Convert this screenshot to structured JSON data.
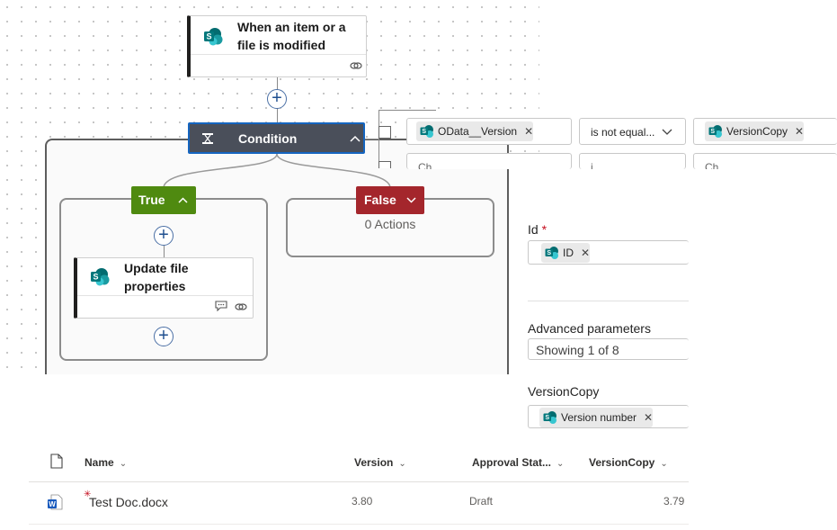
{
  "trigger": {
    "title_line1": "When an item or a",
    "title_line2": "file is modified"
  },
  "condition": {
    "label": "Condition"
  },
  "condition_row": {
    "left_token": "OData__Version",
    "operator": "is not equal...",
    "right_token": "VersionCopy",
    "second_row_left": "Ch",
    "second_row_op": "i",
    "second_row_right": "Ch"
  },
  "true_branch": {
    "label": "True"
  },
  "false_branch": {
    "label": "False",
    "empty_text": "0 Actions"
  },
  "action": {
    "title_line1": "Update file",
    "title_line2": "properties"
  },
  "panel": {
    "id_label": "Id",
    "id_required": "*",
    "id_token": "ID",
    "advanced_label": "Advanced parameters",
    "advanced_value": "Showing 1 of 8",
    "versioncopy_label": "VersionCopy",
    "versioncopy_token": "Version number"
  },
  "library": {
    "columns": [
      "Name",
      "Version",
      "Approval Stat...",
      "VersionCopy"
    ],
    "rows": [
      {
        "name": "Test Doc.docx",
        "version": "3.80",
        "approval": "Draft",
        "versioncopy": "3.79"
      }
    ]
  },
  "colors": {
    "true": "#4f8a10",
    "false": "#a4262c",
    "condition_bg": "#4a4f5a",
    "focus_border": "#1565c0",
    "sharepoint": "#038387"
  }
}
